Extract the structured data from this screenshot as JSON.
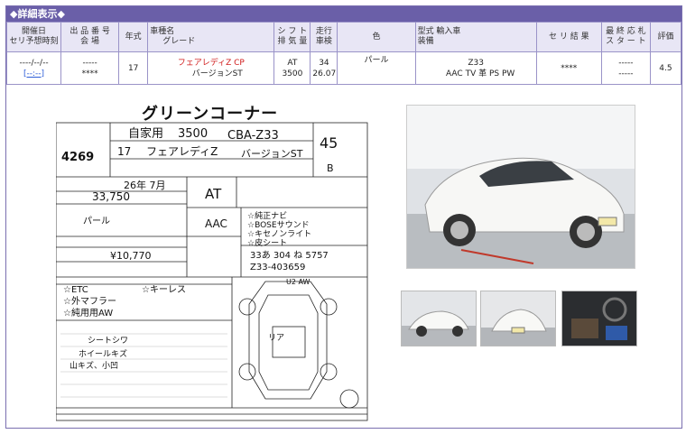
{
  "header": {
    "title": "◆詳細表示◆"
  },
  "table": {
    "columns": [
      {
        "line1": "開催日",
        "line2": "セリ予想時刻"
      },
      {
        "line1": "出 品 番 号",
        "line2": "会      場"
      },
      {
        "line1": "年式",
        "line2": ""
      },
      {
        "line1": "車種名",
        "line2": "グレード"
      },
      {
        "line1": "シ フ ト",
        "line2": "排 気 量"
      },
      {
        "line1": "走行",
        "line2": "車検"
      },
      {
        "line1": "色",
        "line2": ""
      },
      {
        "line1": "型式    輸入車",
        "line2": "装備"
      },
      {
        "line1": "セ リ 結 果",
        "line2": ""
      },
      {
        "line1": "最 終 応 札",
        "line2": "ス タ ー ト"
      },
      {
        "line1": "評価",
        "line2": ""
      }
    ],
    "row": {
      "date": "----/--/--",
      "time": "[--:--]",
      "lot": "-----",
      "venue": "****",
      "year": "17",
      "car_name": "フェアレディZ  CP",
      "grade": "バージョンST",
      "shift": "AT",
      "displacement": "3500",
      "mileage": "34",
      "inspection": "26.07",
      "color": "パール",
      "model": "Z33",
      "equipment": "AAC TV 革 PS PW",
      "result": "****",
      "final_bid": "-----",
      "start": "-----",
      "score": "4.5"
    }
  },
  "sheet": {
    "title": "グリーンコーナー",
    "lot_no": "4269",
    "displacement_hw": "3500",
    "model_hw": "CBA-Z33",
    "car_hw": "フェアレディZ",
    "grade_hw": "バージョンST",
    "year_hw": "17",
    "shaken_hw": "26年7月",
    "mileage_hw": "33,750",
    "shift_hw": "AT",
    "ac_hw": "AAC",
    "score_hw": "4.5",
    "interior_hw": "B",
    "color_hw": "パール",
    "price_hw": "¥10,770",
    "plate_hw": "z33-403659",
    "points": [
      "☆純正ナビ",
      "☆BOSEサウンド",
      "☆キセノンライト",
      "☆皮シート"
    ],
    "notes": [
      "☆ETC",
      "☆キーレス",
      "☆外マフラー",
      "☆純用用AW"
    ],
    "damages": [
      "シートシワ",
      "ホイールキズ",
      "山キズ、小凹"
    ]
  },
  "colors": {
    "title_bar": "#6a5fa8",
    "header_bg": "#e8e6f5",
    "car_name": "#d01a1a",
    "link": "#2a5bd7"
  }
}
